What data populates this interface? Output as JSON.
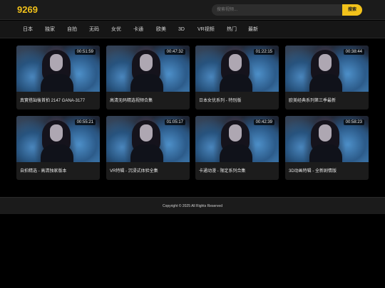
{
  "header": {
    "logo": "9269",
    "search_placeholder": "搜索视频...",
    "search_button": "搜索"
  },
  "nav": [
    "日本",
    "独家",
    "自拍",
    "无码",
    "女优",
    "卡通",
    "欧美",
    "3D",
    "VR视频",
    "热门",
    "最新"
  ],
  "videos": [
    {
      "duration": "00:51:59",
      "title": "真實搭訕後首拍 2147 GANA-3177"
    },
    {
      "duration": "00:47:32",
      "title": "高清无码精选视频合集"
    },
    {
      "duration": "01:22:15",
      "title": "日本女优系列 - 特别版"
    },
    {
      "duration": "00:38:44",
      "title": "欧美经典系列第三季最新"
    },
    {
      "duration": "00:55:21",
      "title": "自拍精选 - 高清独家版本"
    },
    {
      "duration": "01:05:17",
      "title": "VR特辑 - 沉浸式体验全集"
    },
    {
      "duration": "00:42:39",
      "title": "卡通动漫 - 限定系列合集"
    },
    {
      "duration": "00:58:23",
      "title": "3D动画特辑 - 全新剧情版"
    }
  ],
  "footer": {
    "copyright": "Copyright © 2025 All Rights Reserved"
  }
}
